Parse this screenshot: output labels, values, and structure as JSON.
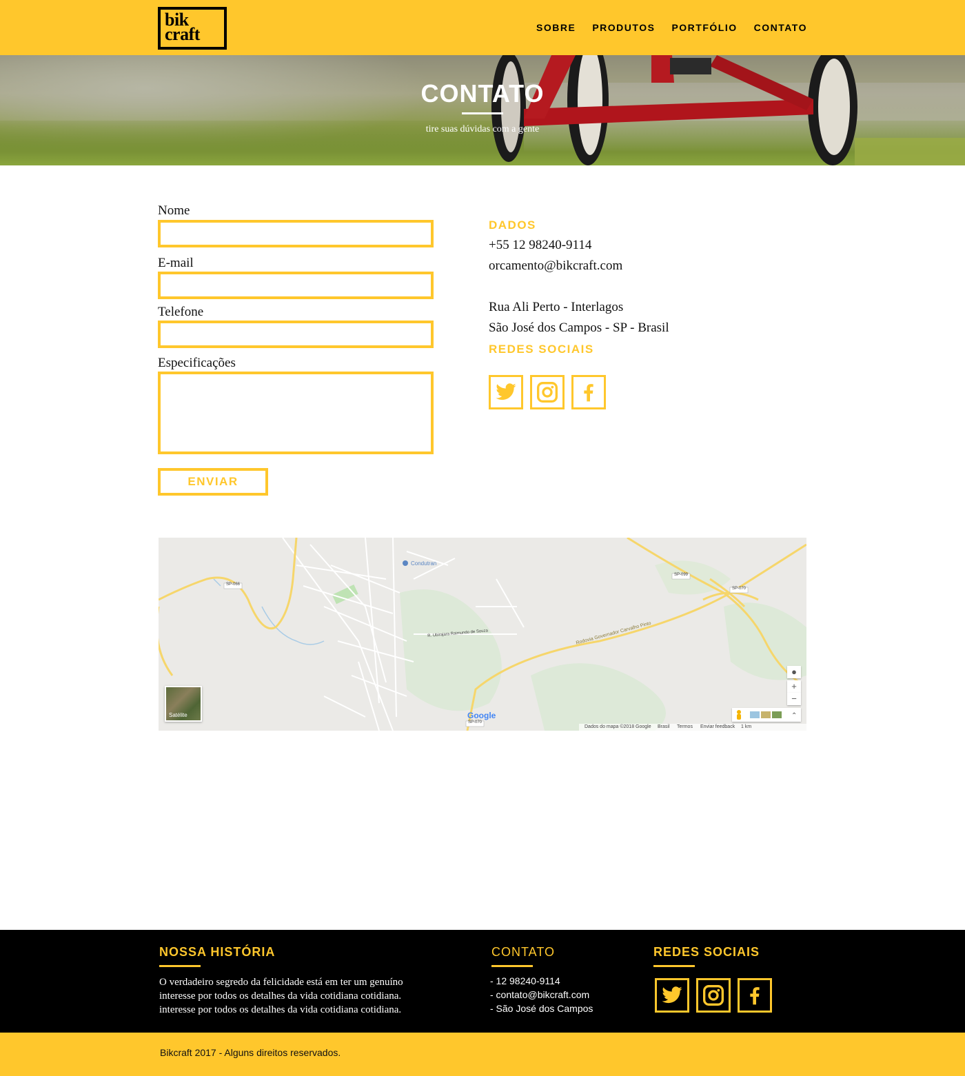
{
  "brand": {
    "logo_line1": "bik",
    "logo_line2": "craft"
  },
  "nav": {
    "items": [
      "SOBRE",
      "PRODUTOS",
      "PORTFÓLIO",
      "CONTATO"
    ]
  },
  "hero": {
    "title": "CONTATO",
    "subtitle": "tire suas dúvidas com a gente"
  },
  "form": {
    "name_label": "Nome",
    "email_label": "E-mail",
    "phone_label": "Telefone",
    "specs_label": "Especificações",
    "submit_label": "ENVIAR"
  },
  "info": {
    "data_heading": "DADOS",
    "phone": "+55 12 98240-9114",
    "email": "orcamento@bikcraft.com",
    "address_line1": "Rua Ali Perto - Interlagos",
    "address_line2": "São José dos Campos - SP - Brasil",
    "social_heading": "REDES SOCIAIS",
    "social_icons": [
      "twitter-icon",
      "instagram-icon",
      "facebook-icon"
    ]
  },
  "map": {
    "place_label": "Condutran",
    "road_label": "Rodovia Governador Carvalho Pinto",
    "street_label_1": "R. Ubirajara Raimundo de Souza",
    "route_labels": [
      "SP-066",
      "SP-099",
      "SP-070",
      "SP-070"
    ],
    "satellite_label": "Satélite",
    "google_label": "Google",
    "footer_data": "Dados do mapa ©2018 Google",
    "footer_country": "Brasil",
    "footer_terms": "Termos",
    "footer_feedback": "Enviar feedback",
    "footer_scale": "1 km",
    "zoom_in": "+",
    "zoom_out": "−"
  },
  "footer": {
    "history_heading": "NOSSA HISTÓRIA",
    "history_lines": [
      "O verdadeiro segredo da felicidade está em ter um genuíno",
      "interesse por todos os detalhes da vida cotidiana cotidiana.",
      "interesse por todos os detalhes da vida cotidiana cotidiana."
    ],
    "contact_heading": "CONTATO",
    "contact_lines": [
      "- 12 98240-9114",
      "- contato@bikcraft.com",
      "- São José dos Campos"
    ],
    "social_heading": "REDES SOCIAIS",
    "copyright": "Bikcraft 2017 - Alguns direitos reservados."
  },
  "colors": {
    "accent": "#FFC72C",
    "dark": "#000000",
    "text": "#111111"
  }
}
